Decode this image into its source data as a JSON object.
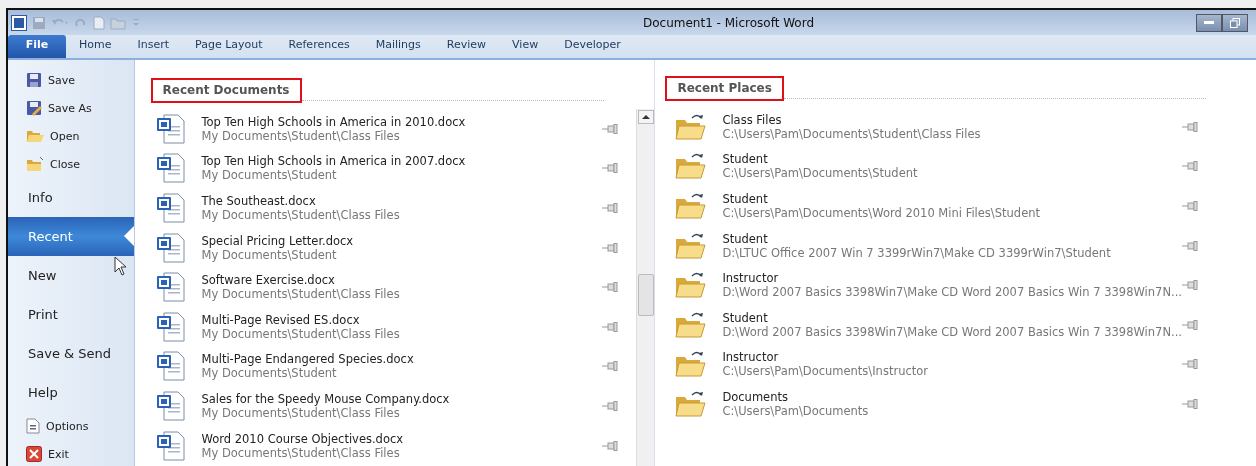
{
  "window": {
    "title": "Document1  -  Microsoft Word"
  },
  "tabs": [
    {
      "label": "File",
      "selected": true
    },
    {
      "label": "Home",
      "selected": false
    },
    {
      "label": "Insert",
      "selected": false
    },
    {
      "label": "Page Layout",
      "selected": false
    },
    {
      "label": "References",
      "selected": false
    },
    {
      "label": "Mailings",
      "selected": false
    },
    {
      "label": "Review",
      "selected": false
    },
    {
      "label": "View",
      "selected": false
    },
    {
      "label": "Developer",
      "selected": false
    }
  ],
  "sidebar": {
    "items": [
      {
        "label": "Save",
        "kind": "command",
        "selected": false
      },
      {
        "label": "Save As",
        "kind": "command",
        "selected": false
      },
      {
        "label": "Open",
        "kind": "command",
        "selected": false
      },
      {
        "label": "Close",
        "kind": "command",
        "selected": false
      },
      {
        "label": "Info",
        "kind": "section",
        "selected": false
      },
      {
        "label": "Recent",
        "kind": "section",
        "selected": true
      },
      {
        "label": "New",
        "kind": "section",
        "selected": false
      },
      {
        "label": "Print",
        "kind": "section",
        "selected": false
      },
      {
        "label": "Save & Send",
        "kind": "section",
        "selected": false
      },
      {
        "label": "Help",
        "kind": "section",
        "selected": false
      },
      {
        "label": "Options",
        "kind": "command",
        "selected": false
      },
      {
        "label": "Exit",
        "kind": "command",
        "selected": false
      }
    ]
  },
  "recent_documents": {
    "heading": "Recent Documents",
    "items": [
      {
        "name": "Top Ten High Schools in America in 2010.docx",
        "path": "My Documents\\Student\\Class Files"
      },
      {
        "name": "Top Ten High Schools in America in 2007.docx",
        "path": "My Documents\\Student"
      },
      {
        "name": "The Southeast.docx",
        "path": "My Documents\\Student\\Class Files"
      },
      {
        "name": "Special Pricing Letter.docx",
        "path": "My Documents\\Student"
      },
      {
        "name": "Software Exercise.docx",
        "path": "My Documents\\Student\\Class Files"
      },
      {
        "name": "Multi-Page Revised ES.docx",
        "path": "My Documents\\Student\\Class Files"
      },
      {
        "name": "Multi-Page Endangered Species.docx",
        "path": "My Documents\\Student"
      },
      {
        "name": "Sales for the Speedy Mouse Company.docx",
        "path": "My Documents\\Student\\Class Files"
      },
      {
        "name": "Word 2010 Course Objectives.docx",
        "path": "My Documents\\Student\\Class Files"
      }
    ]
  },
  "recent_places": {
    "heading": "Recent Places",
    "items": [
      {
        "name": "Class Files",
        "path": "C:\\Users\\Pam\\Documents\\Student\\Class Files"
      },
      {
        "name": "Student",
        "path": "C:\\Users\\Pam\\Documents\\Student"
      },
      {
        "name": "Student",
        "path": "C:\\Users\\Pam\\Documents\\Word 2010 Mini Files\\Student"
      },
      {
        "name": "Student",
        "path": "D:\\LTUC Office 2007 Win 7 3399rWin7\\Make CD 3399rWin7\\Student"
      },
      {
        "name": "Instructor",
        "path": "D:\\Word 2007 Basics 3398Win7\\Make CD Word 2007 Basics Win 7 3398Win7N..."
      },
      {
        "name": "Student",
        "path": "D:\\Word 2007 Basics 3398Win7\\Make CD Word 2007 Basics Win 7 3398Win7N..."
      },
      {
        "name": "Instructor",
        "path": "C:\\Users\\Pam\\Documents\\Instructor"
      },
      {
        "name": "Documents",
        "path": "C:\\Users\\Pam\\Documents"
      }
    ]
  }
}
